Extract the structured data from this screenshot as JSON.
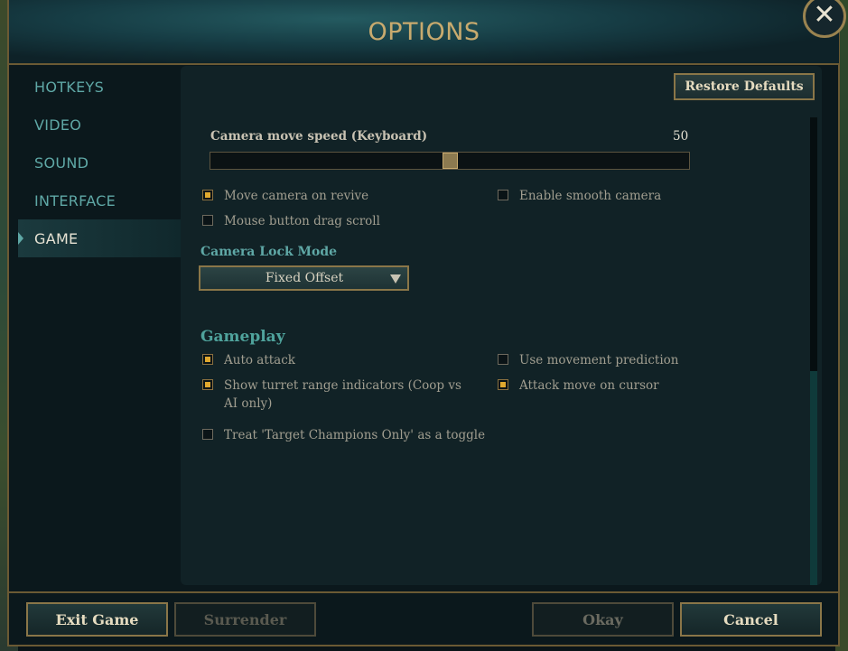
{
  "window": {
    "title": "OPTIONS",
    "close_symbol": "✕"
  },
  "sidebar": {
    "items": [
      {
        "label": "HOTKEYS",
        "active": false
      },
      {
        "label": "VIDEO",
        "active": false
      },
      {
        "label": "SOUND",
        "active": false
      },
      {
        "label": "INTERFACE",
        "active": false
      },
      {
        "label": "GAME",
        "active": true
      }
    ]
  },
  "panel": {
    "restore_defaults_label": "Restore Defaults",
    "camera_speed": {
      "label": "Camera move speed (Keyboard)",
      "value": "50",
      "value_fraction": 0.5
    },
    "checkboxes_camera": [
      {
        "label": "Move camera on revive",
        "checked": true
      },
      {
        "label": "Enable smooth camera",
        "checked": false
      },
      {
        "label": "Mouse button drag scroll",
        "checked": false
      }
    ],
    "camera_lock": {
      "label": "Camera Lock Mode",
      "selected": "Fixed Offset"
    },
    "gameplay": {
      "title": "Gameplay",
      "checkboxes": [
        {
          "label": "Auto attack",
          "checked": true
        },
        {
          "label": "Use movement prediction",
          "checked": false
        },
        {
          "label": "Show turret range indicators (Coop vs AI only)",
          "checked": true
        },
        {
          "label": "Attack move on cursor",
          "checked": true
        },
        {
          "label": "Treat 'Target Champions Only' as a toggle",
          "checked": false
        }
      ]
    }
  },
  "footer": {
    "exit_game": "Exit Game",
    "surrender": "Surrender",
    "okay": "Okay",
    "cancel": "Cancel"
  },
  "colors": {
    "accent_gold": "#c8aa6e",
    "checkbox_on": "#e0a82e",
    "nav_teal": "#5fa8a6"
  }
}
